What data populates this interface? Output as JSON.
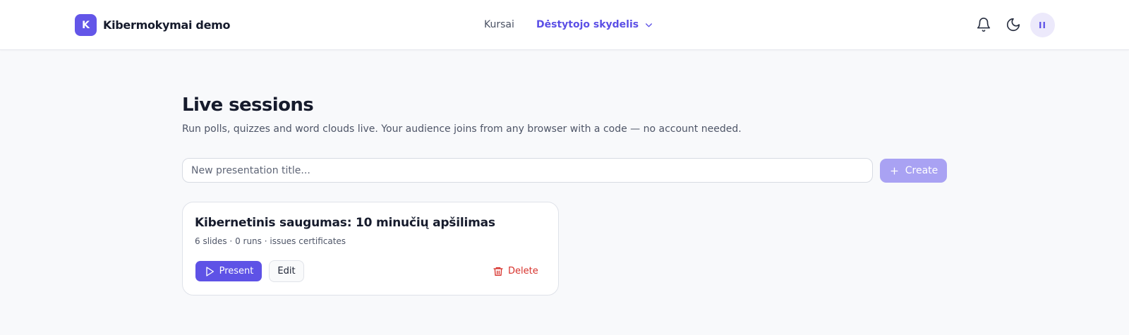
{
  "brand": {
    "logo_letter": "K",
    "name": "Kibermokymai demo"
  },
  "nav": {
    "courses": "Kursai",
    "dashboard": "Dėstytojo skydelis"
  },
  "header": {
    "avatar_initials": "II",
    "icons": [
      "bell-icon",
      "moon-icon",
      "chevron-down-icon"
    ]
  },
  "page": {
    "title": "Live sessions",
    "subtitle": "Run polls, quizzes and word clouds live. Your audience joins from any browser with a code — no account needed."
  },
  "new_presentation": {
    "placeholder": "New presentation title...",
    "value": "",
    "create_label": "Create"
  },
  "presentations": [
    {
      "title": "Kibernetinis saugumas: 10 minučių apšilimas",
      "meta": "6 slides · 0 runs · issues certificates",
      "present_label": "Present",
      "edit_label": "Edit",
      "delete_label": "Delete"
    }
  ],
  "colors": {
    "accent": "#5e52e6",
    "accent_disabled": "#a9a2f3",
    "danger": "#d7312b",
    "page_background": "#f8f9fb"
  }
}
